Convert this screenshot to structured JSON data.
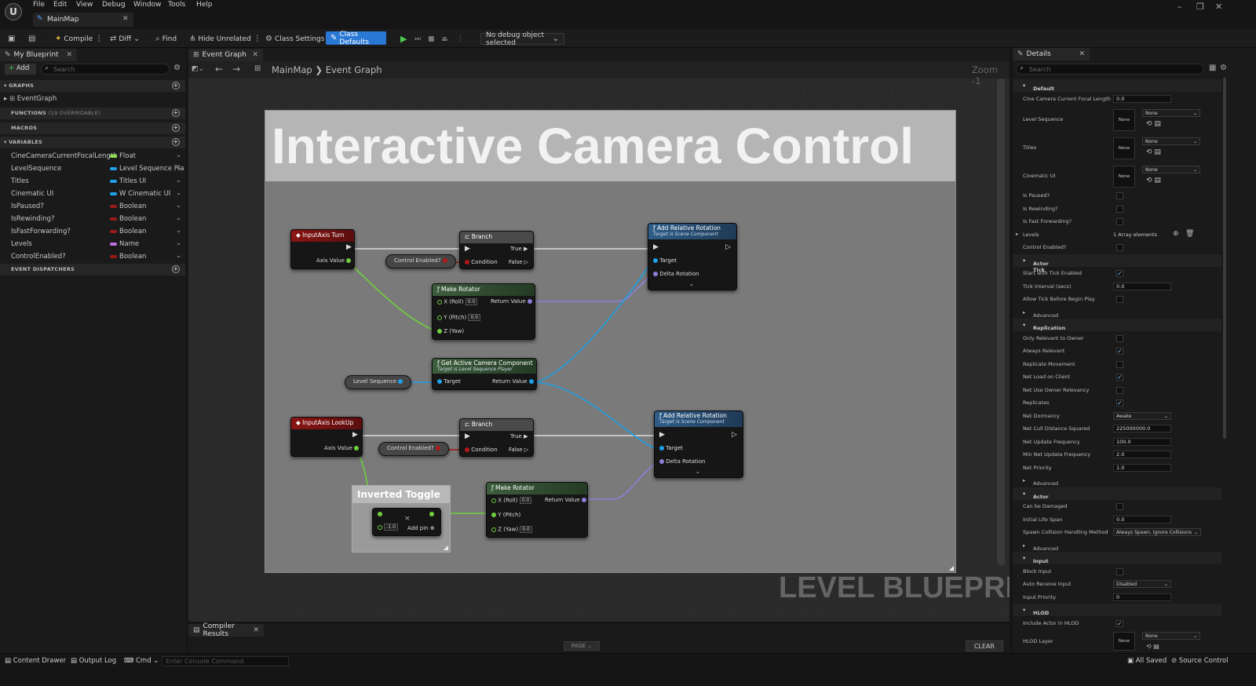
{
  "menu": [
    "File",
    "Edit",
    "View",
    "Debug",
    "Window",
    "Tools",
    "Help"
  ],
  "document_tab": "MainMap",
  "toolbar": {
    "compile": "Compile",
    "diff": "Diff",
    "find": "Find",
    "hide_unrelated": "Hide Unrelated",
    "class_settings": "Class Settings",
    "class_defaults": "Class Defaults",
    "debug_object": "No debug object selected"
  },
  "my_blueprint": {
    "tab": "My Blueprint",
    "add": "Add",
    "search_placeholder": "Search",
    "graphs_header": "GRAPHS",
    "event_graph": "EventGraph",
    "functions_header": "FUNCTIONS",
    "functions_overridable": "(19 OVERRIDABLE)",
    "macros_header": "MACROS",
    "variables_header": "VARIABLES",
    "variables": [
      {
        "name": "CineCameraCurrentFocalLength",
        "type": "Float",
        "color": "#8ee04a"
      },
      {
        "name": "LevelSequence",
        "type": "Level Sequence Pla",
        "color": "#1fa0e8"
      },
      {
        "name": "Titles",
        "type": "Titles UI",
        "color": "#1fa0e8"
      },
      {
        "name": "Cinematic UI",
        "type": "W Cinematic UI",
        "color": "#1fa0e8"
      },
      {
        "name": "IsPaused?",
        "type": "Boolean",
        "color": "#9a1a1a"
      },
      {
        "name": "IsRewinding?",
        "type": "Boolean",
        "color": "#9a1a1a"
      },
      {
        "name": "IsFastForwarding?",
        "type": "Boolean",
        "color": "#9a1a1a"
      },
      {
        "name": "Levels",
        "type": "Name",
        "color": "#c070e0"
      },
      {
        "name": "ControlEnabled?",
        "type": "Boolean",
        "color": "#9a1a1a"
      }
    ],
    "event_dispatchers_header": "EVENT DISPATCHERS"
  },
  "graph": {
    "tab": "Event Graph",
    "breadcrumb_map": "MainMap",
    "breadcrumb_graph": "Event Graph",
    "zoom": "Zoom -1",
    "comment_title": "Interactive Camera Control",
    "watermark": "LEVEL BLUEPRINT",
    "nodes": {
      "input_turn": {
        "title": "InputAxis Turn",
        "axis_value": "Axis Value"
      },
      "branch1": {
        "title": "Branch",
        "true": "True",
        "false": "False",
        "condition": "Condition"
      },
      "control_enabled_1": "Control Enabled?",
      "add_rot_1": {
        "title": "Add Relative Rotation",
        "subtitle": "Target is Scene Component",
        "target": "Target",
        "delta": "Delta Rotation"
      },
      "make_rot_1": {
        "title": "Make Rotator",
        "x": "X (Roll)",
        "y": "Y (Pitch)",
        "z": "Z (Yaw)",
        "x_val": "0.0",
        "y_val": "0.0",
        "ret": "Return Value"
      },
      "get_cam": {
        "title": "Get Active Camera Component",
        "subtitle": "Target is Level Sequence Player",
        "target": "Target",
        "ret": "Return Value"
      },
      "level_sequence": "Level Sequence",
      "input_lookup": {
        "title": "InputAxis LookUp",
        "axis_value": "Axis Value"
      },
      "control_enabled_2": "Control Enabled?",
      "branch2": {
        "title": "Branch",
        "true": "True",
        "false": "False",
        "condition": "Condition"
      },
      "add_rot_2": {
        "title": "Add Relative Rotation",
        "subtitle": "Target is Scene Component",
        "target": "Target",
        "delta": "Delta Rotation"
      },
      "inverted_toggle": {
        "title": "Inverted Toggle",
        "value": "-1.0",
        "add_pin": "Add pin"
      },
      "make_rot_2": {
        "title": "Make Rotator",
        "x": "X (Roll)",
        "y": "Y (Pitch)",
        "z": "Z (Yaw)",
        "x_val": "0.0",
        "z_val": "0.0",
        "ret": "Return Value"
      }
    }
  },
  "compiler": {
    "tab": "Compiler Results",
    "page": "PAGE",
    "clear": "CLEAR"
  },
  "details": {
    "tab": "Details",
    "search_placeholder": "Search",
    "sections": {
      "default": "Default",
      "actor_tick": "Actor Tick",
      "replication": "Replication",
      "actor": "Actor",
      "input": "Input",
      "hlod": "HLOD",
      "advanced": "Advanced"
    },
    "focal_length_label": "Cine Camera Current Focal Length",
    "focal_length_value": "0.0",
    "level_sequence_label": "Level Sequence",
    "titles_label": "Titles",
    "cinematic_ui_label": "Cinematic UI",
    "none": "None",
    "is_paused": "Is Paused?",
    "is_rewinding": "Is Rewinding?",
    "is_fast_forwarding": "Is Fast Forwarding?",
    "levels_label": "Levels",
    "levels_value": "1 Array elements",
    "control_enabled": "Control Enabled?",
    "start_tick": "Start with Tick Enabled",
    "tick_interval": "Tick Interval (secs)",
    "tick_interval_value": "0.0",
    "allow_tick": "Allow Tick Before Begin Play",
    "only_relevant": "Only Relevant to Owner",
    "always_relevant": "Always Relevant",
    "replicate_movement": "Replicate Movement",
    "net_load": "Net Load on Client",
    "net_use_owner": "Net Use Owner Relevancy",
    "replicates": "Replicates",
    "net_dormancy": "Net Dormancy",
    "net_dormancy_value": "Awake",
    "net_cull": "Net Cull Distance Squared",
    "net_cull_value": "225000000.0",
    "net_update": "Net Update Frequency",
    "net_update_value": "100.0",
    "min_net_update": "Min Net Update Frequency",
    "min_net_update_value": "2.0",
    "net_priority": "Net Priority",
    "net_priority_value": "1.0",
    "can_be_damaged": "Can be Damaged",
    "initial_life": "Initial Life Span",
    "initial_life_value": "0.0",
    "spawn_collision": "Spawn Collision Handling Method",
    "spawn_collision_value": "Always Spawn, Ignore Collisions",
    "block_input": "Block Input",
    "auto_receive": "Auto Receive Input",
    "auto_receive_value": "Disabled",
    "input_priority": "Input Priority",
    "input_priority_value": "0",
    "include_hlod": "Include Actor in HLOD",
    "hlod_layer": "HLOD Layer"
  },
  "statusbar": {
    "content_drawer": "Content Drawer",
    "output_log": "Output Log",
    "cmd": "Cmd",
    "console_placeholder": "Enter Console Command",
    "all_saved": "All Saved",
    "source_control": "Source Control"
  }
}
